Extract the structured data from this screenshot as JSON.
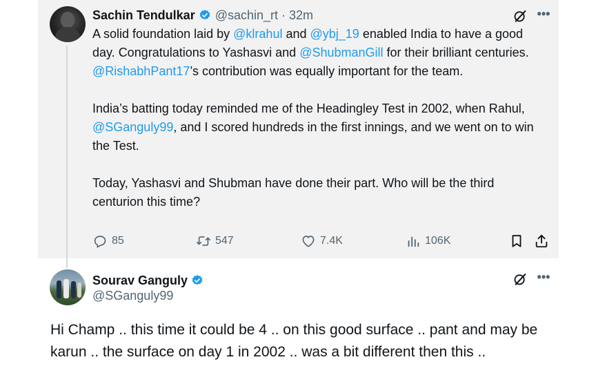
{
  "parent_tweet": {
    "author_name": "Sachin Tendulkar",
    "author_handle": "@sachin_rt",
    "separator": "·",
    "time": "32m",
    "paragraph_1": {
      "t1": "A solid foundation laid by ",
      "m1": "@klrahul",
      "t2": " and ",
      "m2": "@ybj_19",
      "t3": " enabled India to have a good day. Congratulations to Yashasvi and ",
      "m3": "@ShubmanGill",
      "t4": " for their brilliant centuries. ",
      "m4": "@RishabhPant17",
      "t5": "’s contribution was equally important for the team."
    },
    "paragraph_2": {
      "t1": "India’s batting today reminded me of the Headingley Test in 2002, when Rahul, ",
      "m1": "@SGanguly99",
      "t2": ", and I scored hundreds in the first innings, and we went on to win the Test."
    },
    "paragraph_3": "Today, Yashasvi and Shubman have done their part. Who will be the third centurion this time?",
    "stats": {
      "replies": "85",
      "reposts": "547",
      "likes": "7.4K",
      "views": "106K"
    }
  },
  "reply": {
    "author_name": "Sourav Ganguly",
    "author_handle": "@SGanguly99",
    "text": "Hi Champ .. this time it could be 4 .. on this good surface .. pant  and may be karun .. the surface on day 1 in 2002 .. was a bit different then this .."
  },
  "icons": {
    "verified": "verified-badge-icon",
    "grok": "grok-icon",
    "more": "more-icon",
    "reply": "reply-icon",
    "repost": "repost-icon",
    "like": "like-icon",
    "views": "views-icon",
    "bookmark": "bookmark-icon",
    "share": "share-icon"
  },
  "colors": {
    "link": "#1d9bf0",
    "secondary_text": "#536471",
    "primary_text": "#0f1419",
    "parent_background": "#f2f2f2"
  }
}
